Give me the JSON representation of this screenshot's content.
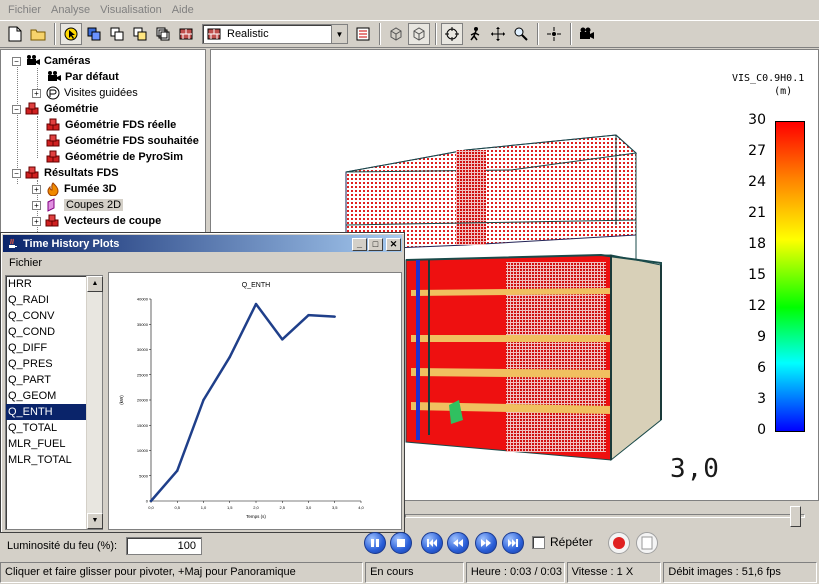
{
  "menu": [
    "Fichier",
    "Analyse",
    "Visualisation",
    "Aide"
  ],
  "toolbar": {
    "render_mode": "Realistic"
  },
  "tree": {
    "items": [
      {
        "label": "Caméras",
        "bold": true
      },
      {
        "label": "Par défaut",
        "bold": true
      },
      {
        "label": "Visites guidées",
        "bold": false
      },
      {
        "label": "Géométrie",
        "bold": true
      },
      {
        "label": "Géométrie FDS réelle",
        "bold": true
      },
      {
        "label": "Géométrie FDS souhaitée",
        "bold": true
      },
      {
        "label": "Géométrie de PyroSim",
        "bold": true
      },
      {
        "label": "Résultats FDS",
        "bold": true
      },
      {
        "label": "Fumée 3D",
        "bold": true
      },
      {
        "label": "Coupes 2D",
        "bold": false
      },
      {
        "label": "Vecteurs de coupe",
        "bold": true
      }
    ]
  },
  "colorbar": {
    "title_line1": "VIS_C0.9H0.1",
    "title_line2": "(m)",
    "labels": [
      "30",
      "27",
      "24",
      "21",
      "18",
      "15",
      "12",
      "9",
      "6",
      "3",
      "0"
    ]
  },
  "time_display": "3,0",
  "time_history": {
    "title": "Time History Plots",
    "menu": "Fichier",
    "items": [
      "HRR",
      "Q_RADI",
      "Q_CONV",
      "Q_COND",
      "Q_DIFF",
      "Q_PRES",
      "Q_PART",
      "Q_GEOM",
      "Q_ENTH",
      "Q_TOTAL",
      "MLR_FUEL",
      "MLR_TOTAL"
    ],
    "selected": "Q_ENTH"
  },
  "chart_data": {
    "type": "line",
    "title": "Q_ENTH",
    "xlabel": "Temps (s)",
    "ylabel": "(kW)",
    "x": [
      0,
      0.5,
      1.0,
      1.5,
      2.0,
      2.5,
      3.0,
      3.5
    ],
    "values": [
      0,
      6000,
      20000,
      28500,
      39000,
      32000,
      36800,
      36500
    ],
    "xticks": [
      "0,0",
      "0,5",
      "1,0",
      "1,5",
      "2,0",
      "2,5",
      "3,0",
      "3,5",
      "4,0"
    ],
    "yticks": [
      "0",
      "5000",
      "10000",
      "15000",
      "20000",
      "25000",
      "30000",
      "35000",
      "40000"
    ],
    "xlim": [
      0,
      4
    ],
    "ylim": [
      0,
      40000
    ],
    "color": "#1f3f8a"
  },
  "luminosity": {
    "label": "Luminosité du feu (%):",
    "value": "100"
  },
  "repeat_label": "Répéter",
  "status": {
    "hint": "Cliquer et faire glisser pour pivoter, +Maj pour Panoramique",
    "state": "En cours",
    "time": "Heure : 0:03 / 0:03",
    "speed": "Vitesse : 1 X",
    "fps": "Débit images : 51,6 fps"
  }
}
